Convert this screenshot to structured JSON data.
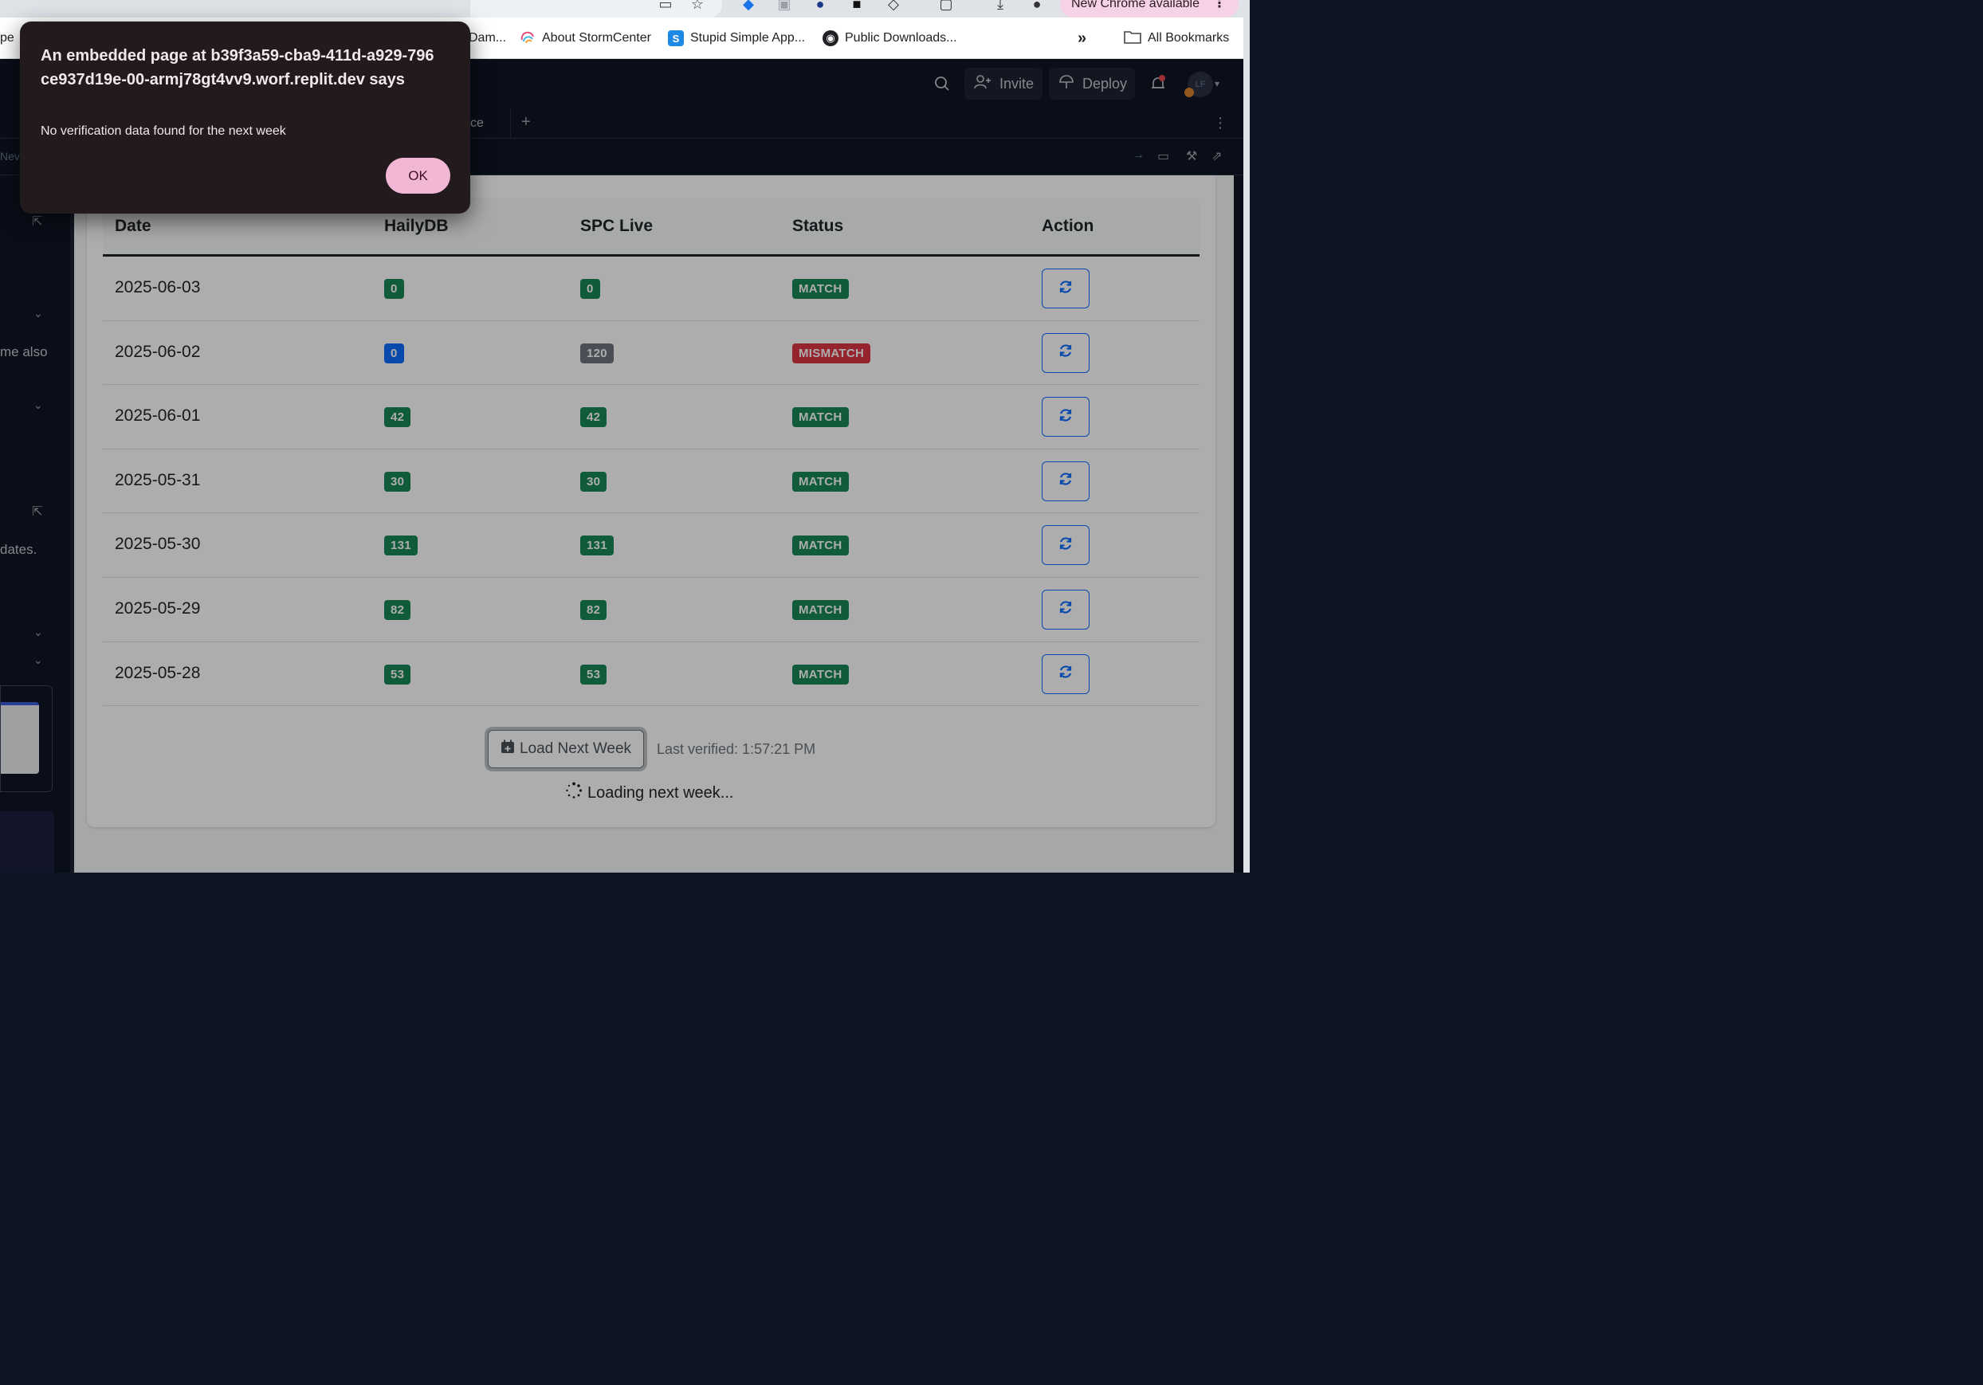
{
  "browser": {
    "update_label": "New Chrome available",
    "menu_glyph": "⋮",
    "overflow_glyph": "»",
    "bookmarks": [
      {
        "label": "Dam...",
        "icon": "folder-partial"
      },
      {
        "label": "About StormCenter",
        "icon": "stormcenter-icon"
      },
      {
        "label": "Stupid Simple App...",
        "icon": "s-icon"
      },
      {
        "label": "Public Downloads...",
        "icon": "globe-icon"
      }
    ],
    "all_bookmarks": "All Bookmarks",
    "partial_left": "pe"
  },
  "replit": {
    "invite_label": "Invite",
    "deploy_label": "Deploy",
    "avatar_initials": "LF",
    "tab_fragment": "ce",
    "new_tab_glyph": "+",
    "url_fragment": "Nev",
    "left_pane_texts": {
      "line1": "me also",
      "line2": " dates."
    }
  },
  "table": {
    "headers": [
      "Date",
      "HailyDB",
      "SPC Live",
      "Status",
      "Action"
    ],
    "rows": [
      {
        "date": "2025-06-03",
        "haily": "0",
        "spc": "0",
        "status": "MATCH"
      },
      {
        "date": "2025-06-02",
        "haily": "0",
        "spc": "120",
        "status": "MISMATCH"
      },
      {
        "date": "2025-06-01",
        "haily": "42",
        "spc": "42",
        "status": "MATCH"
      },
      {
        "date": "2025-05-31",
        "haily": "30",
        "spc": "30",
        "status": "MATCH"
      },
      {
        "date": "2025-05-30",
        "haily": "131",
        "spc": "131",
        "status": "MATCH"
      },
      {
        "date": "2025-05-29",
        "haily": "82",
        "spc": "82",
        "status": "MATCH"
      },
      {
        "date": "2025-05-28",
        "haily": "53",
        "spc": "53",
        "status": "MATCH"
      }
    ]
  },
  "footer": {
    "load_button": "Load Next Week",
    "last_verified": "Last verified: 1:57:21 PM",
    "loading": "Loading next week..."
  },
  "dialog": {
    "title": "An embedded page at b39f3a59-cba9-411d-a929-796ce937d19e-00-armj78gt4vv9.worf.replit.dev says",
    "message": "No verification data found for the next week",
    "ok": "OK"
  },
  "colors": {
    "match": "#198754",
    "mismatch": "#dc3545",
    "primary": "#0d6efd",
    "secondary": "#6c757d",
    "dialog_bg": "#221a1d",
    "ok_bg": "#f3b7d6"
  }
}
